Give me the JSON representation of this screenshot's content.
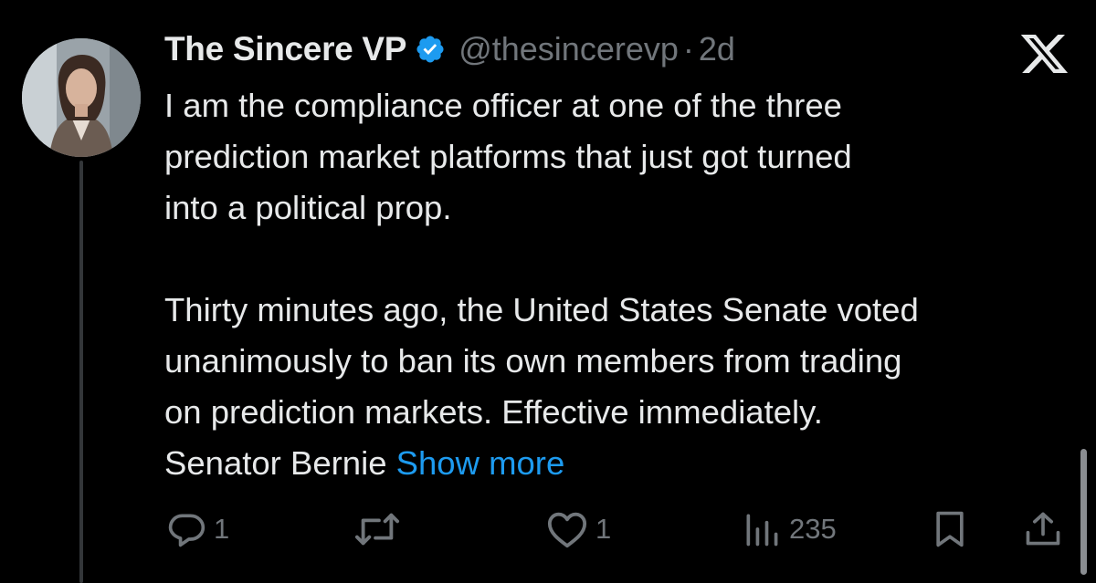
{
  "post": {
    "author": {
      "display_name": "The Sincere VP",
      "handle": "@thesincerevp",
      "separator": "·",
      "time_ago": "2d",
      "verified": true
    },
    "text_lines_p1": [
      "I am the compliance officer at one of the three",
      "prediction market platforms that just got turned",
      "into a political prop."
    ],
    "text_lines_p2": [
      "Thirty minutes ago, the United States Senate voted",
      "unanimously to ban its own members from trading",
      "on prediction markets. Effective immediately."
    ],
    "last_line_text": "Senator Bernie ",
    "show_more_label": "Show more",
    "metrics": {
      "replies": "1",
      "retweets": "",
      "likes": "1",
      "views": "235"
    }
  },
  "icons": {
    "verified": "verified-badge-icon",
    "x_logo": "x-logo-icon",
    "reply": "reply-icon",
    "retweet": "retweet-icon",
    "like": "heart-icon",
    "views": "views-bar-chart-icon",
    "bookmark": "bookmark-icon",
    "share": "share-icon"
  },
  "colors": {
    "background": "#000000",
    "text": "#e7e9ea",
    "muted": "#71767b",
    "accent": "#1d9bf0"
  }
}
